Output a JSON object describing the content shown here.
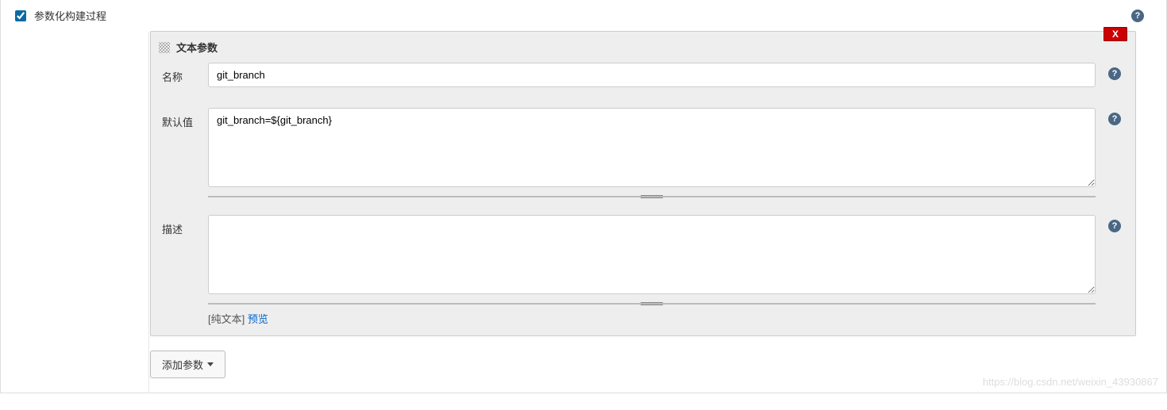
{
  "section": {
    "checkbox_label": "参数化构建过程",
    "checkbox_checked": true
  },
  "param": {
    "title": "文本参数",
    "delete_label": "X",
    "fields": {
      "name_label": "名称",
      "name_value": "git_branch",
      "default_label": "默认值",
      "default_value": "git_branch=${git_branch}",
      "desc_label": "描述",
      "desc_value": ""
    },
    "format_hint_plain": "[纯文本]",
    "format_hint_link": "预览"
  },
  "add_button_label": "添加参数",
  "watermark": "https://blog.csdn.net/weixin_43930867",
  "help_icon_text": "?"
}
